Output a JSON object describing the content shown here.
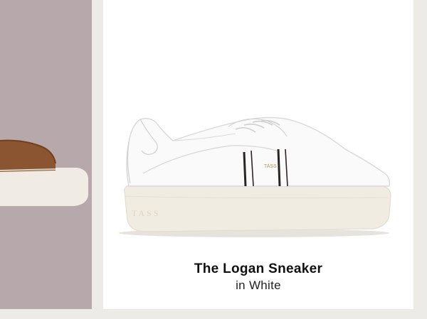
{
  "product": {
    "name": "The Logan Sneaker",
    "color_line": "in White",
    "sole_brand": "TASS"
  },
  "colors": {
    "page_background": "#ecebe8",
    "left_panel": "#b7a9ab",
    "card": "#ffffff",
    "upper": "#fafafa",
    "sole": "#f1ece1",
    "stripe": "#2a2522",
    "brown_leather": "#8a5530"
  },
  "icons": {
    "left_image": "brown-sneaker-partial-image",
    "main_image": "white-sneaker-image"
  }
}
